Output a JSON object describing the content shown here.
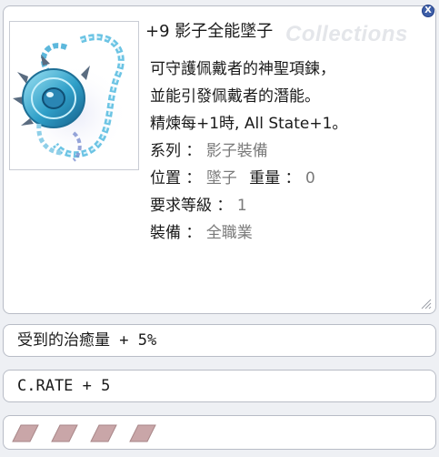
{
  "item": {
    "title": "+9 影子全能墜子",
    "watermark": "Collections",
    "image_icon": "shadow-pendant-icon",
    "description": [
      "可守護佩戴者的神聖項鍊，",
      "並能引發佩戴者的潛能。",
      "精煉每+1時, All State+1。"
    ],
    "properties": {
      "type_label": "系列 ：",
      "type_value": "影子裝備",
      "position_label": "位置 ：",
      "position_value": "墜子",
      "weight_label": "重量 ：",
      "weight_value": "0",
      "level_label": "要求等級 ：",
      "level_value": "1",
      "equip_label": "裝備 ：",
      "equip_value": "全職業"
    }
  },
  "close_button": {
    "icon": "close-icon",
    "label": "X"
  },
  "bonuses": [
    "受到的治癒量 + 5%",
    "C.RATE + 5"
  ],
  "card_slots": {
    "count": 4,
    "color": "#c9a6a8"
  },
  "colors": {
    "panel_border": "#b8bcc6",
    "value_gray": "#7a7a7a",
    "close_blue": "#3e5fa8"
  }
}
